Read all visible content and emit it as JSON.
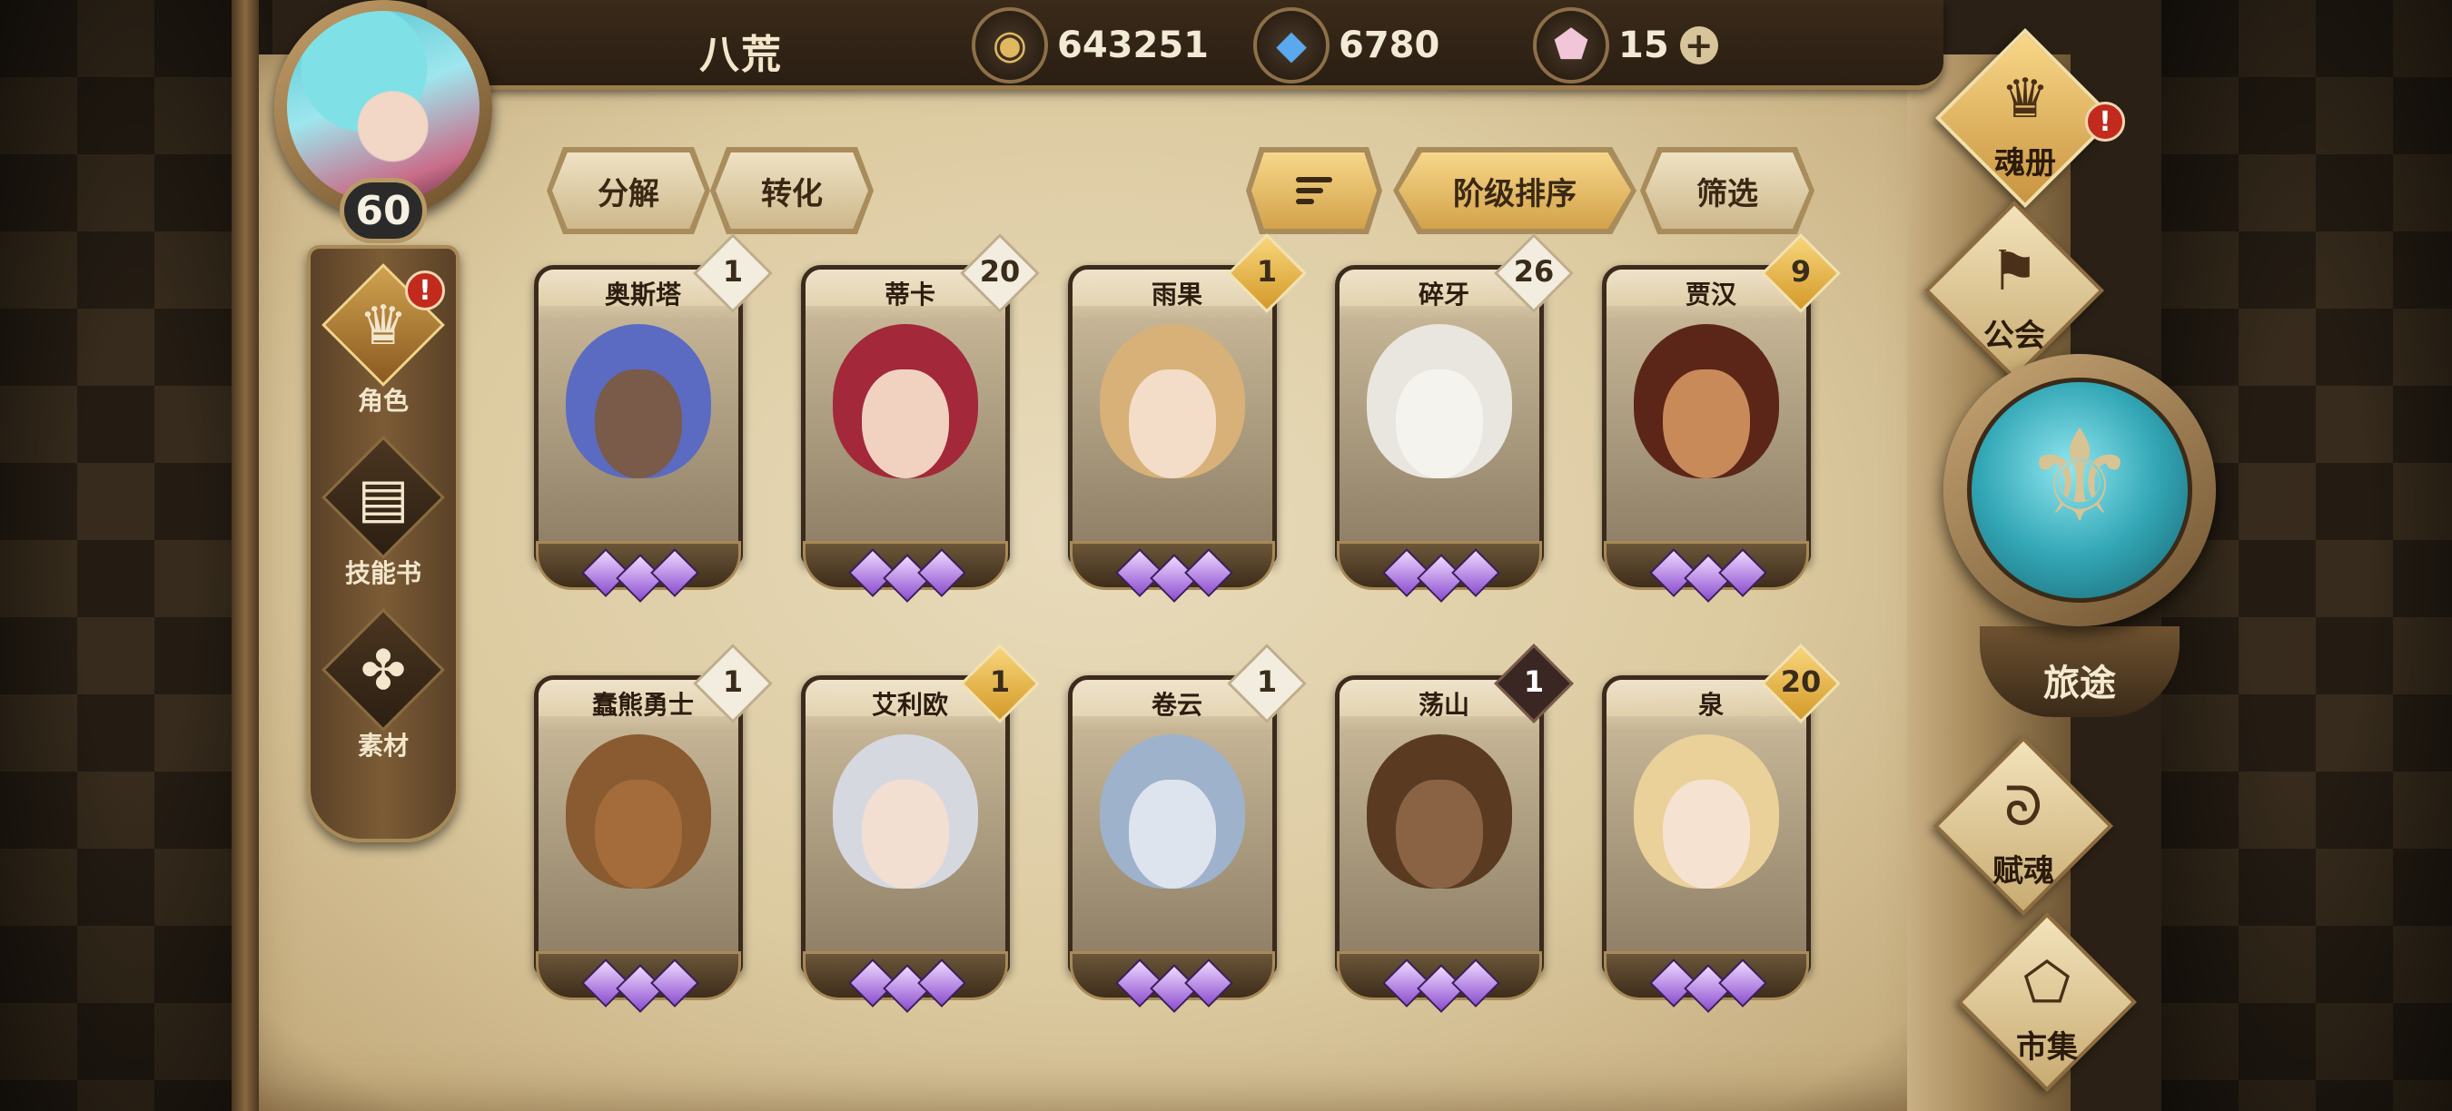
{
  "player": {
    "name": "八荒",
    "level": "60"
  },
  "currencies": [
    {
      "icon": "gold-coin-icon",
      "value": "643251"
    },
    {
      "icon": "blue-crystal-icon",
      "value": "6780"
    },
    {
      "icon": "pink-gem-icon",
      "value": "15"
    }
  ],
  "sidebar": {
    "items": [
      {
        "label": "角色",
        "icon": "character-icon",
        "active": true,
        "alert": "!"
      },
      {
        "label": "技能书",
        "icon": "skill-book-icon",
        "active": false
      },
      {
        "label": "素材",
        "icon": "material-icon",
        "active": false
      }
    ]
  },
  "toolbar": {
    "decompose_label": "分解",
    "convert_label": "转化",
    "sort_label": "阶级排序",
    "filter_label": "筛选"
  },
  "heroes": [
    {
      "name": "奥斯塔",
      "count": "1",
      "badge": "white",
      "hair": "#5b6bc2",
      "face": "#7a5a48"
    },
    {
      "name": "蒂卡",
      "count": "20",
      "badge": "white",
      "hair": "#a2283a",
      "face": "#f1d2c0"
    },
    {
      "name": "雨果",
      "count": "1",
      "badge": "gold",
      "hair": "#d7b178",
      "face": "#f3ddc8"
    },
    {
      "name": "碎牙",
      "count": "26",
      "badge": "white",
      "hair": "#e9e6df",
      "face": "#f5f3ee"
    },
    {
      "name": "贾汉",
      "count": "9",
      "badge": "gold",
      "hair": "#5b2618",
      "face": "#c98a5a"
    },
    {
      "name": "蠢熊勇士",
      "count": "1",
      "badge": "white",
      "hair": "#8a5a30",
      "face": "#a46c3a"
    },
    {
      "name": "艾利欧",
      "count": "1",
      "badge": "gold",
      "hair": "#d6d8e0",
      "face": "#f2dfd2"
    },
    {
      "name": "卷云",
      "count": "1",
      "badge": "white",
      "hair": "#9eb2cc",
      "face": "#dde4ee"
    },
    {
      "name": "荡山",
      "count": "1",
      "badge": "dark",
      "hair": "#5a3b22",
      "face": "#8a6344"
    },
    {
      "name": "泉",
      "count": "20",
      "badge": "gold",
      "hair": "#ead19a",
      "face": "#f6e2d0"
    }
  ],
  "right_menu": {
    "soul_book": {
      "label": "魂册",
      "alert": "!"
    },
    "guild": {
      "label": "公会"
    },
    "journey": {
      "label": "旅途"
    },
    "soul_grant": {
      "label": "赋魂"
    },
    "market": {
      "label": "市集"
    }
  },
  "colors": {
    "accent_gold": "#d3a24a",
    "alert_red": "#c22a1e",
    "parchment": "#e9dcbc"
  }
}
